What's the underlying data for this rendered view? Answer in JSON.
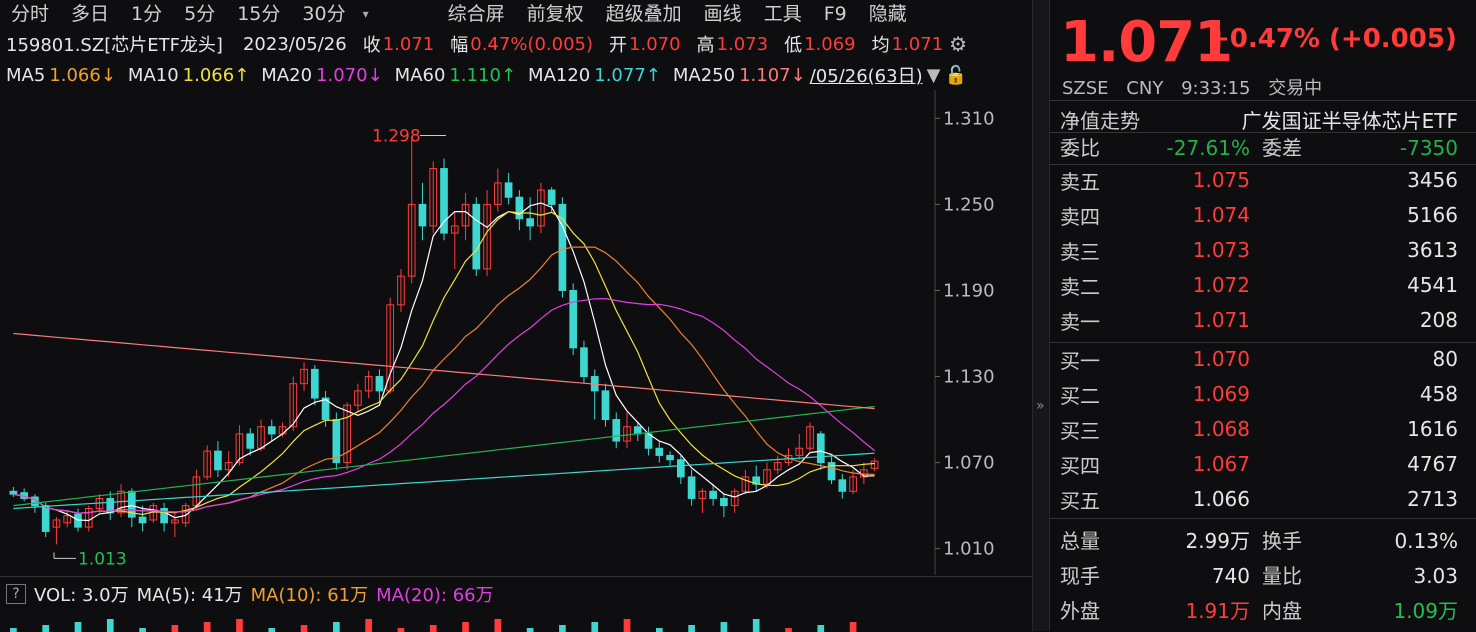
{
  "toolbar": {
    "items": [
      "分时",
      "多日",
      "1分",
      "5分",
      "15分",
      "30分",
      "▾",
      "综合屏",
      "前复权",
      "超级叠加",
      "画线",
      "工具",
      "F9",
      "隐藏"
    ]
  },
  "info": {
    "code": "159801.SZ[芯片ETF龙头]",
    "date": "2023/05/26",
    "close_label": "收",
    "close": "1.071",
    "range_label": "幅",
    "range": "0.47%(0.005)",
    "open_label": "开",
    "open": "1.070",
    "high_label": "高",
    "high": "1.073",
    "low_label": "低",
    "low": "1.069",
    "avg_label": "均",
    "avg": "1.071"
  },
  "ma": {
    "ma5_label": "MA5",
    "ma5": "1.066↓",
    "ma10_label": "MA10",
    "ma10": "1.066↑",
    "ma20_label": "MA20",
    "ma20": "1.070↓",
    "ma60_label": "MA60",
    "ma60": "1.110↑",
    "ma120_label": "MA120",
    "ma120": "1.077↑",
    "ma250_label": "MA250",
    "ma250": "1.107↓",
    "range_text": "/05/26(63日)"
  },
  "axis": {
    "ticks": [
      "1.310",
      "1.250",
      "1.190",
      "1.130",
      "1.070",
      "1.010"
    ],
    "high_mark": "1.298",
    "low_mark": "1.013"
  },
  "vol": {
    "q": "?",
    "vol": "VOL: 3.0万",
    "ma5": "MA(5): 41万",
    "ma10": "MA(10): 61万",
    "ma20": "MA(20): 66万"
  },
  "colors": {
    "up": "#ff3b3b",
    "down": "#3dd6d0",
    "ma5": "#ffffff",
    "ma10": "#f0e040",
    "ma20": "#e040e0",
    "ma60": "#23b14d",
    "ma120": "#3dd6d0",
    "ma250": "#ff7a7a"
  },
  "quote": {
    "price": "1.071",
    "change": "+0.47% (+0.005)",
    "exchange": "SZSE",
    "currency": "CNY",
    "time": "9:33:15",
    "status": "交易中",
    "nav_label": "净值走势",
    "fund_name": "广发国证半导体芯片ETF",
    "weibi_label": "委比",
    "weibi": "-27.61%",
    "weicha_label": "委差",
    "weicha": "-7350"
  },
  "asks": [
    {
      "label": "卖五",
      "price": "1.075",
      "vol": "3456"
    },
    {
      "label": "卖四",
      "price": "1.074",
      "vol": "5166"
    },
    {
      "label": "卖三",
      "price": "1.073",
      "vol": "3613"
    },
    {
      "label": "卖二",
      "price": "1.072",
      "vol": "4541"
    },
    {
      "label": "卖一",
      "price": "1.071",
      "vol": "208"
    }
  ],
  "bids": [
    {
      "label": "买一",
      "price": "1.070",
      "vol": "80"
    },
    {
      "label": "买二",
      "price": "1.069",
      "vol": "458"
    },
    {
      "label": "买三",
      "price": "1.068",
      "vol": "1616"
    },
    {
      "label": "买四",
      "price": "1.067",
      "vol": "4767"
    },
    {
      "label": "买五",
      "price": "1.066",
      "vol": "2713"
    }
  ],
  "stats": [
    {
      "a": "总量",
      "b": "2.99万",
      "c": "换手",
      "d": "0.13%"
    },
    {
      "a": "现手",
      "b": "740",
      "c": "量比",
      "d": "3.03"
    },
    {
      "a": "外盘",
      "b": "1.91万",
      "c": "内盘",
      "d": "1.09万"
    }
  ],
  "chart_data": {
    "type": "candlestick",
    "ylim": [
      1.0,
      1.32
    ],
    "candles": [
      [
        1.05,
        1.048,
        1.053,
        1.046
      ],
      [
        1.049,
        1.045,
        1.052,
        1.043
      ],
      [
        1.046,
        1.04,
        1.048,
        1.035
      ],
      [
        1.04,
        1.022,
        1.042,
        1.018
      ],
      [
        1.025,
        1.03,
        1.032,
        1.013
      ],
      [
        1.028,
        1.033,
        1.036,
        1.025
      ],
      [
        1.034,
        1.025,
        1.038,
        1.022
      ],
      [
        1.025,
        1.038,
        1.04,
        1.022
      ],
      [
        1.038,
        1.045,
        1.048,
        1.035
      ],
      [
        1.045,
        1.035,
        1.05,
        1.03
      ],
      [
        1.035,
        1.05,
        1.055,
        1.032
      ],
      [
        1.05,
        1.032,
        1.052,
        1.025
      ],
      [
        1.032,
        1.028,
        1.04,
        1.022
      ],
      [
        1.03,
        1.04,
        1.042,
        1.028
      ],
      [
        1.038,
        1.028,
        1.042,
        1.022
      ],
      [
        1.028,
        1.03,
        1.036,
        1.018
      ],
      [
        1.028,
        1.04,
        1.042,
        1.025
      ],
      [
        1.04,
        1.06,
        1.065,
        1.038
      ],
      [
        1.06,
        1.078,
        1.082,
        1.058
      ],
      [
        1.078,
        1.065,
        1.085,
        1.06
      ],
      [
        1.065,
        1.07,
        1.078,
        1.06
      ],
      [
        1.07,
        1.09,
        1.096,
        1.068
      ],
      [
        1.09,
        1.08,
        1.094,
        1.075
      ],
      [
        1.08,
        1.095,
        1.1,
        1.078
      ],
      [
        1.095,
        1.09,
        1.1,
        1.085
      ],
      [
        1.09,
        1.095,
        1.098,
        1.088
      ],
      [
        1.095,
        1.125,
        1.13,
        1.092
      ],
      [
        1.125,
        1.135,
        1.14,
        1.12
      ],
      [
        1.135,
        1.115,
        1.138,
        1.11
      ],
      [
        1.115,
        1.1,
        1.12,
        1.095
      ],
      [
        1.1,
        1.07,
        1.105,
        1.065
      ],
      [
        1.07,
        1.11,
        1.112,
        1.065
      ],
      [
        1.11,
        1.12,
        1.125,
        1.105
      ],
      [
        1.12,
        1.13,
        1.134,
        1.115
      ],
      [
        1.13,
        1.12,
        1.135,
        1.112
      ],
      [
        1.12,
        1.18,
        1.185,
        1.118
      ],
      [
        1.18,
        1.2,
        1.205,
        1.175
      ],
      [
        1.2,
        1.25,
        1.298,
        1.195
      ],
      [
        1.25,
        1.235,
        1.265,
        1.225
      ],
      [
        1.235,
        1.275,
        1.28,
        1.23
      ],
      [
        1.275,
        1.23,
        1.282,
        1.225
      ],
      [
        1.23,
        1.235,
        1.245,
        1.205
      ],
      [
        1.235,
        1.25,
        1.258,
        1.225
      ],
      [
        1.25,
        1.205,
        1.255,
        1.2
      ],
      [
        1.205,
        1.25,
        1.26,
        1.2
      ],
      [
        1.25,
        1.265,
        1.275,
        1.245
      ],
      [
        1.265,
        1.255,
        1.272,
        1.25
      ],
      [
        1.255,
        1.24,
        1.26,
        1.232
      ],
      [
        1.24,
        1.235,
        1.255,
        1.225
      ],
      [
        1.235,
        1.26,
        1.265,
        1.23
      ],
      [
        1.26,
        1.25,
        1.262,
        1.245
      ],
      [
        1.25,
        1.19,
        1.255,
        1.185
      ],
      [
        1.19,
        1.15,
        1.195,
        1.145
      ],
      [
        1.15,
        1.13,
        1.155,
        1.125
      ],
      [
        1.13,
        1.12,
        1.135,
        1.1
      ],
      [
        1.12,
        1.1,
        1.125,
        1.095
      ],
      [
        1.1,
        1.085,
        1.105,
        1.08
      ],
      [
        1.085,
        1.095,
        1.105,
        1.08
      ],
      [
        1.095,
        1.09,
        1.098,
        1.085
      ],
      [
        1.09,
        1.08,
        1.095,
        1.075
      ],
      [
        1.08,
        1.075,
        1.085,
        1.07
      ],
      [
        1.075,
        1.072,
        1.078,
        1.068
      ],
      [
        1.072,
        1.06,
        1.075,
        1.055
      ],
      [
        1.06,
        1.045,
        1.065,
        1.04
      ],
      [
        1.045,
        1.05,
        1.052,
        1.035
      ],
      [
        1.05,
        1.045,
        1.055,
        1.04
      ],
      [
        1.045,
        1.04,
        1.048,
        1.032
      ],
      [
        1.04,
        1.05,
        1.052,
        1.035
      ],
      [
        1.05,
        1.06,
        1.065,
        1.048
      ],
      [
        1.06,
        1.055,
        1.068,
        1.05
      ],
      [
        1.055,
        1.065,
        1.07,
        1.052
      ],
      [
        1.065,
        1.07,
        1.075,
        1.062
      ],
      [
        1.07,
        1.075,
        1.08,
        1.068
      ],
      [
        1.075,
        1.08,
        1.09,
        1.072
      ],
      [
        1.08,
        1.095,
        1.098,
        1.078
      ],
      [
        1.09,
        1.07,
        1.092,
        1.065
      ],
      [
        1.07,
        1.058,
        1.075,
        1.055
      ],
      [
        1.058,
        1.05,
        1.062,
        1.045
      ],
      [
        1.05,
        1.06,
        1.065,
        1.048
      ],
      [
        1.06,
        1.065,
        1.07,
        1.055
      ],
      [
        1.066,
        1.071,
        1.073,
        1.064
      ]
    ]
  }
}
